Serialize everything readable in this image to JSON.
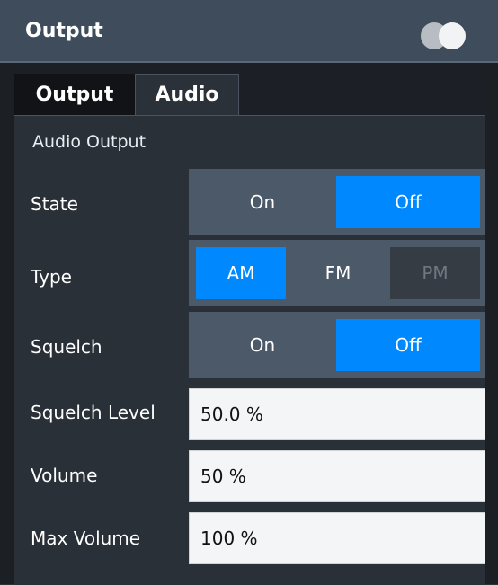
{
  "header": {
    "title": "Output"
  },
  "tabs": [
    {
      "label": "Output"
    },
    {
      "label": "Audio"
    }
  ],
  "section": {
    "label": "Audio Output"
  },
  "state": {
    "label": "State",
    "options": [
      "On",
      "Off"
    ],
    "selected": "Off"
  },
  "type": {
    "label": "Type",
    "options": [
      "AM",
      "FM",
      "PM"
    ],
    "selected": "AM",
    "disabled": [
      "PM"
    ]
  },
  "squelch": {
    "label": "Squelch",
    "options": [
      "On",
      "Off"
    ],
    "selected": "Off"
  },
  "squelch_level": {
    "label": "Squelch Level",
    "value": "50.0 %"
  },
  "volume": {
    "label": "Volume",
    "value": "50 %"
  },
  "max_volume": {
    "label": "Max Volume",
    "value": "100 %"
  },
  "colors": {
    "accent": "#0088ff",
    "title_bar": "#3e4c5b",
    "panel": "#2a3037"
  }
}
